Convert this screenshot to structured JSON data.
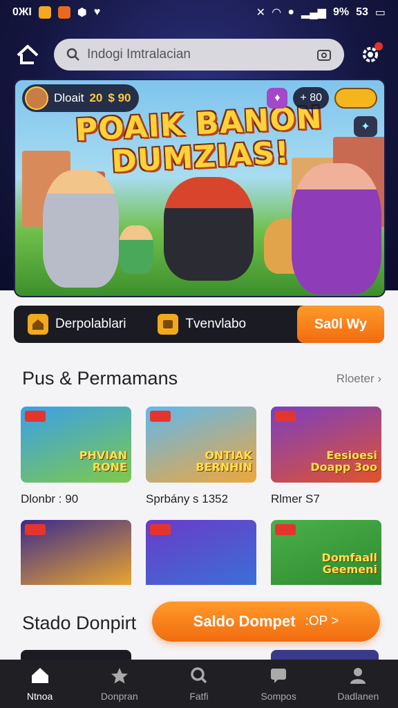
{
  "status_bar": {
    "time": "0ЖI",
    "battery_percent": "9%",
    "battery_level": "53"
  },
  "app_bar": {
    "search_placeholder": "Indogi Imtralacian"
  },
  "hero": {
    "title_line1": "POAIK BANON",
    "title_line2": "DUMZIAS!",
    "player_name": "Dloait",
    "player_level": "20",
    "coins": "$ 90",
    "gems": "+ 80"
  },
  "action_strip": {
    "item1_label": "Derpolablari",
    "item2_label": "Tvenvlabo",
    "cta_label": "Sa0l Wy"
  },
  "section": {
    "title": "Pus & Permamans",
    "more_label": "Rloeter"
  },
  "cards": [
    {
      "art": "PHVIAN\nRONE",
      "label": "Dlonbr : 90",
      "c1": "#3aa0e8",
      "c2": "#7ec94a"
    },
    {
      "art": "ONTIAK\nBERNHIN",
      "label": "Sprbány s 1352",
      "c1": "#5fb8ef",
      "c2": "#f0a63a"
    },
    {
      "art": "Eesioesi\nDoapp 3oo",
      "label": "Rlmer S7",
      "c1": "#7b3fc2",
      "c2": "#e2532c"
    },
    {
      "art": "",
      "label": "",
      "c1": "#3b2a8e",
      "c2": "#e9a52f"
    },
    {
      "art": "",
      "label": "",
      "c1": "#6a3bc8",
      "c2": "#3b6fd6"
    },
    {
      "art": "Domfaall\nGeemeni",
      "label": "",
      "c1": "#4ab04a",
      "c2": "#2f8a2f"
    }
  ],
  "section2": {
    "title": "Stado Donpirt"
  },
  "wallet_button": {
    "label": "Saldo Dompet",
    "suffix": ":OP >"
  },
  "bottom_nav": [
    {
      "label": "Ntnoa",
      "icon": "home-icon"
    },
    {
      "label": "Donpran",
      "icon": "star-icon"
    },
    {
      "label": "Fatfi",
      "icon": "search-icon"
    },
    {
      "label": "Sompos",
      "icon": "chat-icon"
    },
    {
      "label": "Dadlanen",
      "icon": "profile-icon"
    }
  ],
  "colors": {
    "accent": "#f26b0f",
    "header_bg": "#141640",
    "nav_bg": "#202024"
  }
}
